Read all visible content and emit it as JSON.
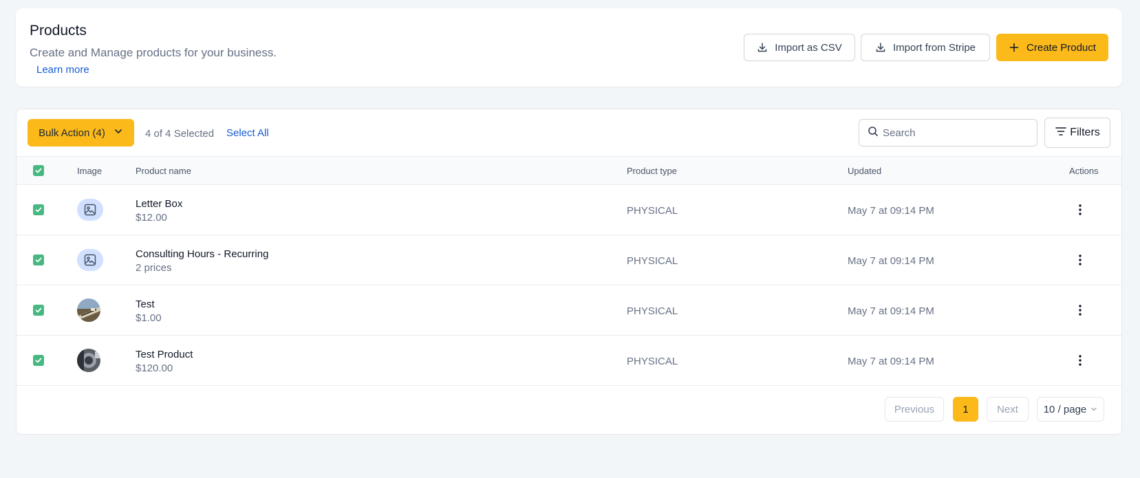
{
  "header": {
    "title": "Products",
    "subtitle": "Create and Manage products for your business.",
    "learn_more": "Learn more",
    "buttons": {
      "import_csv": "Import as CSV",
      "import_stripe": "Import from Stripe",
      "create_product": "Create Product"
    }
  },
  "toolbar": {
    "bulk_action": "Bulk Action (4)",
    "selected_text": "4 of 4 Selected",
    "select_all": "Select All",
    "search_placeholder": "Search",
    "filters": "Filters"
  },
  "table": {
    "columns": {
      "image": "Image",
      "product_name": "Product name",
      "product_type": "Product type",
      "updated": "Updated",
      "actions": "Actions"
    },
    "rows": [
      {
        "name": "Letter Box",
        "sub": "$12.00",
        "type": "PHYSICAL",
        "updated": "May 7 at 09:14 PM",
        "image": "image-placeholder-icon"
      },
      {
        "name": "Consulting Hours - Recurring",
        "sub": "2 prices",
        "type": "PHYSICAL",
        "updated": "May 7 at 09:14 PM",
        "image": "image-placeholder-icon"
      },
      {
        "name": "Test",
        "sub": "$1.00",
        "type": "PHYSICAL",
        "updated": "May 7 at 09:14 PM",
        "image": "product-photo"
      },
      {
        "name": "Test Product",
        "sub": "$120.00",
        "type": "PHYSICAL",
        "updated": "May 7 at 09:14 PM",
        "image": "product-photo"
      }
    ]
  },
  "pagination": {
    "previous": "Previous",
    "current_page": "1",
    "next": "Next",
    "page_size": "10 / page"
  },
  "colors": {
    "accent": "#fbb91a",
    "checkbox": "#47b881",
    "link": "#175cd3",
    "background": "#f2f6f8"
  }
}
